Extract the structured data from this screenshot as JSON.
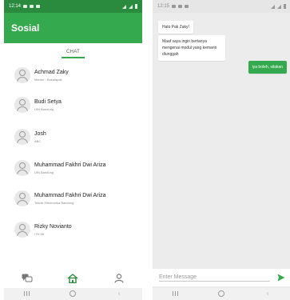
{
  "left": {
    "status_time": "12:14",
    "app_title": "Sosial",
    "tab_chat": "CHAT",
    "contacts": [
      {
        "name": "Achmad Zaky",
        "subtitle": "Mentor · Bukalapak"
      },
      {
        "name": "Budi Setya",
        "subtitle": "UIN Bandung"
      },
      {
        "name": "Josh",
        "subtitle": "ABC"
      },
      {
        "name": "Muhammad Fakhri Dwi Ariza",
        "subtitle": "UIN Bandung"
      },
      {
        "name": "Muhammad Fakhri Dwi Ariza",
        "subtitle": "Teknik Elektronika Bandung"
      },
      {
        "name": "Rizky Novianto",
        "subtitle": "ITH 88"
      }
    ],
    "nav_icons": [
      "chat-bubbles-icon",
      "home-icon",
      "profile-icon"
    ]
  },
  "right": {
    "status_time": "12:15",
    "messages": [
      {
        "text": "Halo Pak Zaky!",
        "from": "other"
      },
      {
        "text": "Maaf saya ingin bertanya mengenai modul yang kemarin diunggah",
        "from": "other"
      },
      {
        "text": "iya boleh, silakan",
        "from": "me"
      }
    ],
    "input_placeholder": "Enter Message"
  },
  "colors": {
    "accent": "#34a94d",
    "status_bar": "#2a8b3e",
    "chat_background": "#ececec"
  }
}
